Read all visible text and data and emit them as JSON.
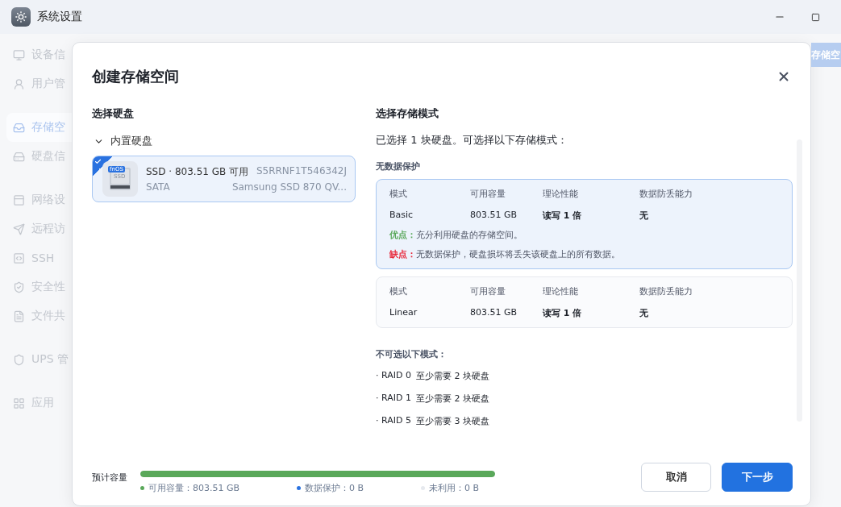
{
  "window": {
    "title": "系统设置"
  },
  "sidebar": {
    "groups": [
      [
        {
          "label": "设备信",
          "selected": false
        },
        {
          "label": "用户管",
          "selected": false
        }
      ],
      [
        {
          "label": "存储空",
          "selected": true
        },
        {
          "label": "硬盘信",
          "selected": false
        }
      ],
      [
        {
          "label": "网络设",
          "selected": false
        },
        {
          "label": "远程访",
          "selected": false
        },
        {
          "label": "SSH",
          "selected": false
        },
        {
          "label": "安全性",
          "selected": false
        },
        {
          "label": "文件共",
          "selected": false
        }
      ],
      [
        {
          "label": "UPS 管",
          "selected": false
        }
      ],
      [
        {
          "label": "应用",
          "selected": false
        }
      ]
    ]
  },
  "background_button": "存储空",
  "dialog": {
    "title": "创建存储空间",
    "disk_section": {
      "title": "选择硬盘",
      "group": {
        "label": "内置硬盘",
        "expanded": true
      },
      "disks": [
        {
          "selected": true,
          "badge": "fnOS",
          "icon_label": "SSD",
          "name": "SSD · 803.51 GB 可用",
          "bus": "SATA",
          "serial": "S5RRNF1T546342J",
          "model": "Samsung SSD 870 QV..."
        }
      ]
    },
    "mode_section": {
      "title": "选择存储模式",
      "summary": "已选择 1 块硬盘。可选择以下存储模式：",
      "group_title": "无数据保护",
      "modes": [
        {
          "selected": true,
          "columns": [
            "模式",
            "可用容量",
            "理论性能",
            "数据防丢能力"
          ],
          "values": [
            "Basic",
            "803.51 GB",
            "读写 1 倍",
            "无"
          ],
          "pro_label": "优点：",
          "pro": "充分利用硬盘的存储空间。",
          "con_label": "缺点：",
          "con": "无数据保护，硬盘损坏将丢失该硬盘上的所有数据。"
        },
        {
          "selected": false,
          "columns": [
            "模式",
            "可用容量",
            "理论性能",
            "数据防丢能力"
          ],
          "values": [
            "Linear",
            "803.51 GB",
            "读写 1 倍",
            "无"
          ]
        }
      ],
      "unavailable_title": "不可选以下模式：",
      "unavailable": [
        {
          "mode": "· RAID 0",
          "requirement": "至少需要 2 块硬盘"
        },
        {
          "mode": "· RAID 1",
          "requirement": "至少需要 2 块硬盘"
        },
        {
          "mode": "· RAID 5",
          "requirement": "至少需要 3 块硬盘"
        }
      ]
    },
    "capacity": {
      "label": "预计容量",
      "level": 1,
      "legend": [
        {
          "text": "可用容量：803.51 GB",
          "color": "#5aa85a"
        },
        {
          "text": "数据保护：0 B",
          "color": "#2a72e0"
        },
        {
          "text": "未利用：0 B",
          "color": "#e6e9ee"
        }
      ]
    },
    "buttons": [
      {
        "label": "取消",
        "kind": "secondary"
      },
      {
        "label": "下一步",
        "kind": "primary"
      }
    ]
  }
}
